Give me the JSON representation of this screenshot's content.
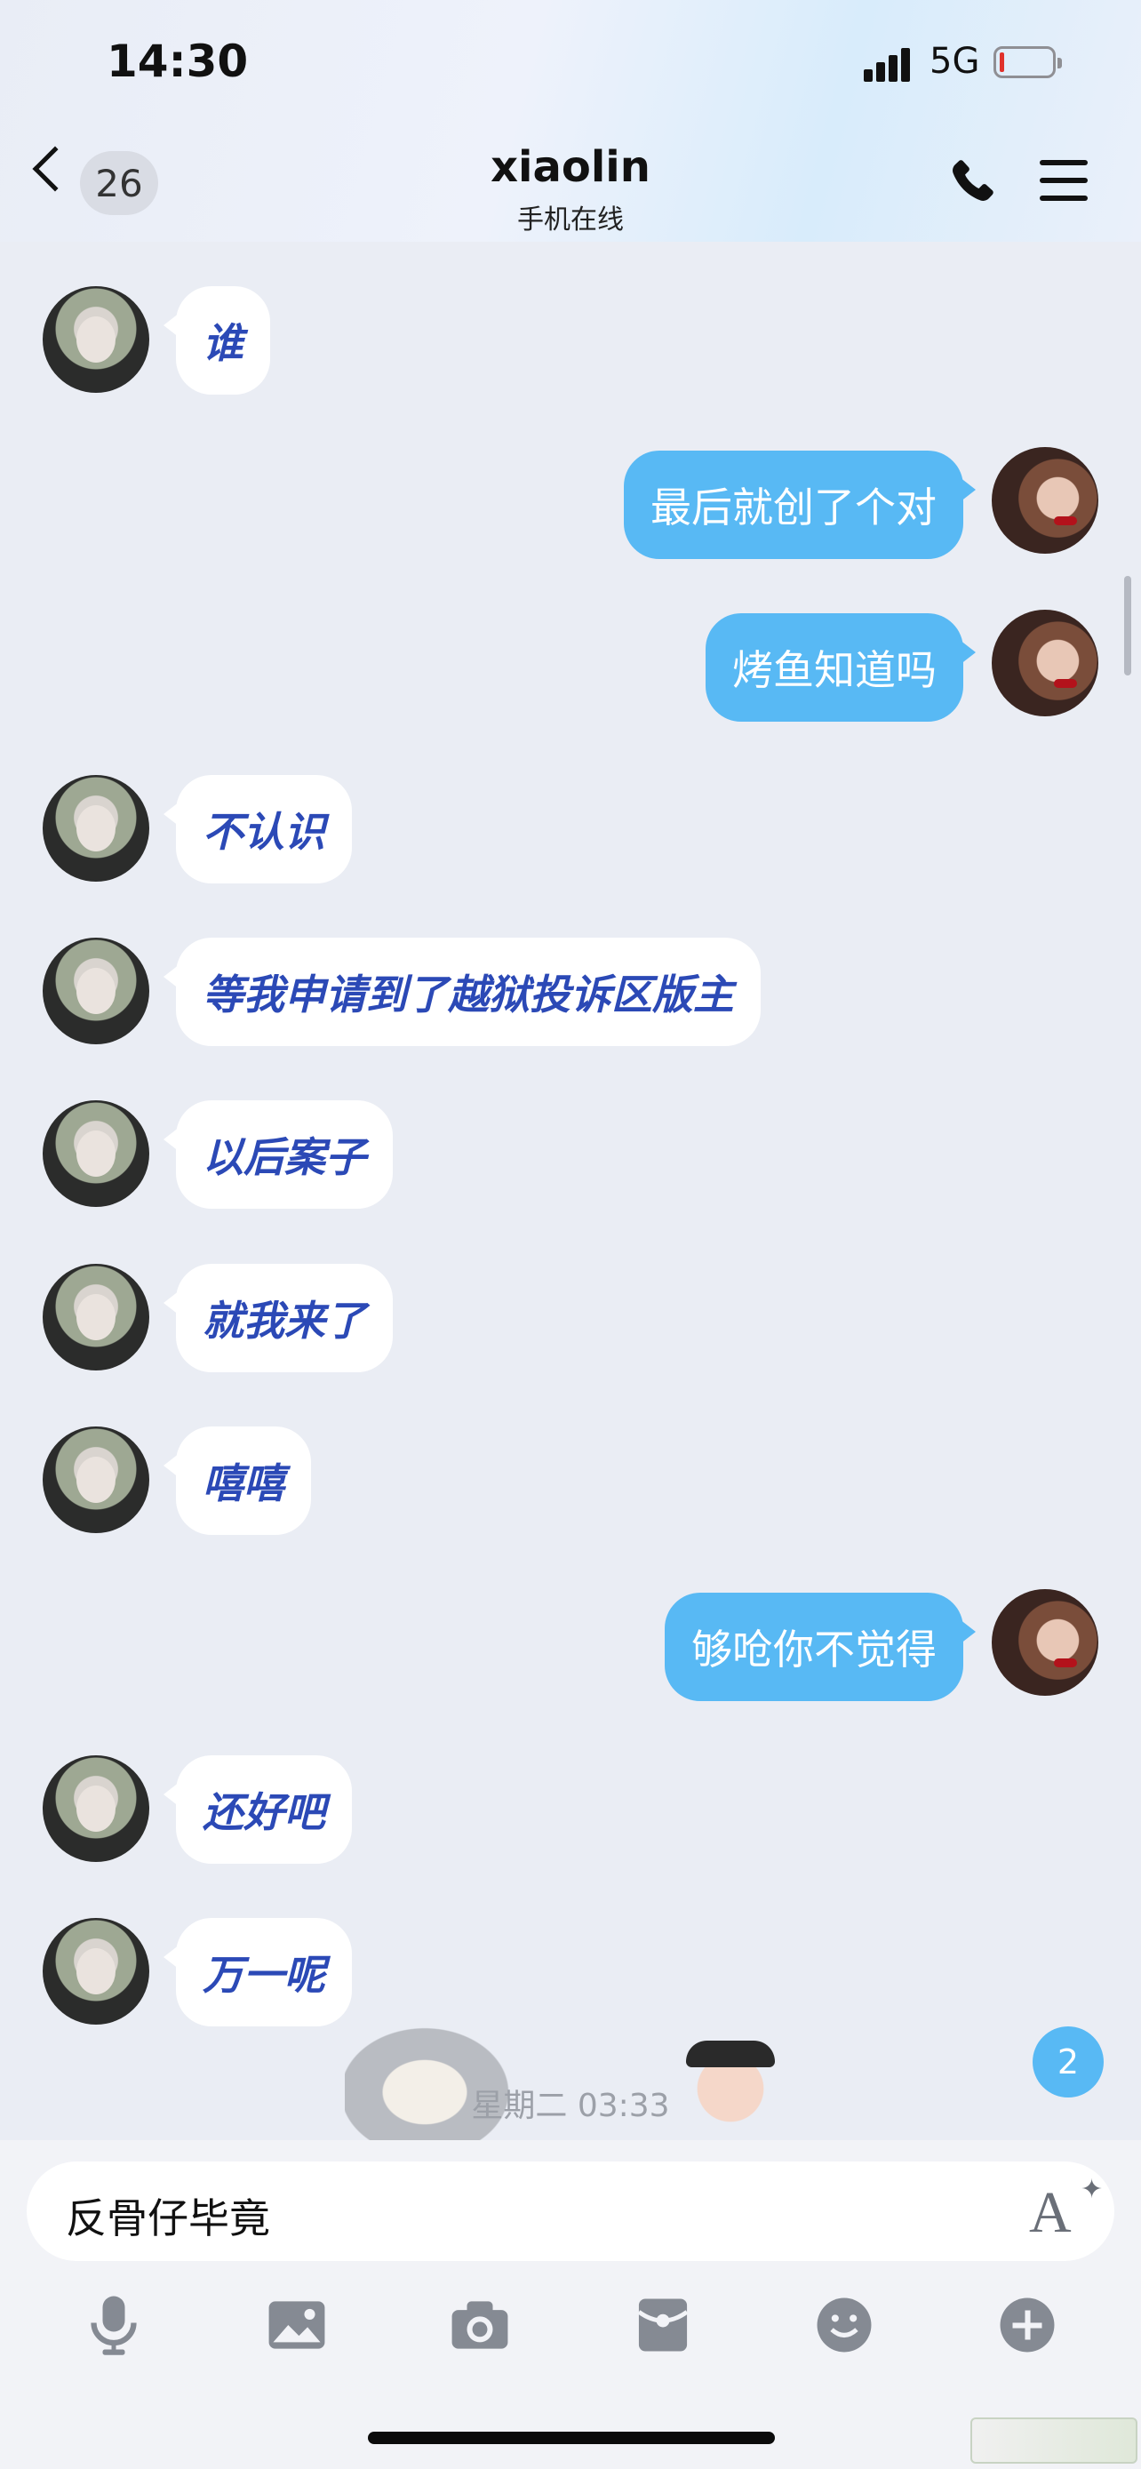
{
  "status_bar": {
    "time": "14:30",
    "network": "5G"
  },
  "header": {
    "unread_count": "26",
    "title": "xiaolin",
    "subtitle": "手机在线"
  },
  "messages": [
    {
      "side": "in",
      "text": "谁"
    },
    {
      "side": "out",
      "text": "最后就创了个对"
    },
    {
      "side": "out",
      "text": "烤鱼知道吗"
    },
    {
      "side": "in",
      "text": "不认识"
    },
    {
      "side": "in",
      "text": "等我申请到了越狱投诉区版主"
    },
    {
      "side": "in",
      "text": "以后案子"
    },
    {
      "side": "in",
      "text": "就我来了"
    },
    {
      "side": "in",
      "text": "嘻嘻"
    },
    {
      "side": "out",
      "text": "够呛你不觉得"
    },
    {
      "side": "in",
      "text": "还好吧"
    },
    {
      "side": "in",
      "text": "万一呢"
    }
  ],
  "timestamp": "星期二 03:33",
  "new_message_badge": "2",
  "composer": {
    "text": "反骨仔毕竟",
    "font_button": "A"
  },
  "toolbar_icons": [
    "microphone-icon",
    "image-icon",
    "camera-icon",
    "red-packet-icon",
    "emoji-icon",
    "plus-icon"
  ],
  "colors": {
    "outgoing_bubble": "#58b9f4",
    "incoming_text": "#2b49b6",
    "background": "#eaedf4"
  }
}
